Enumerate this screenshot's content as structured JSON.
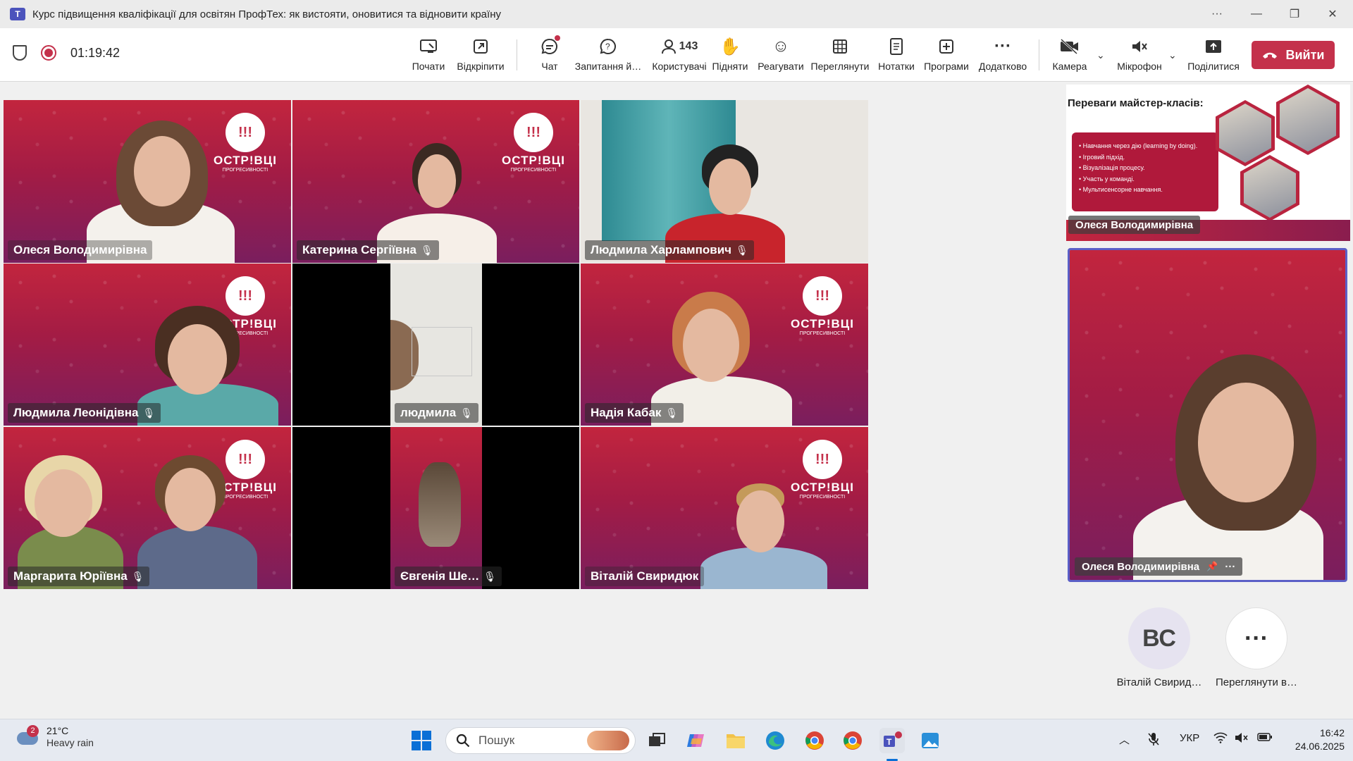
{
  "window": {
    "title": "Курс підвищення кваліфікації для освітян ПрофТех: як вистояти, оновитися та відновити країну",
    "controls": {
      "more": "···",
      "minimize": "—",
      "restore": "❐",
      "close": "✕"
    }
  },
  "toolbar": {
    "timer": "01:19:42",
    "buttons": [
      {
        "label": "Почати",
        "icon": "start-presenting-icon"
      },
      {
        "label": "Відкріпити",
        "icon": "unpin-icon"
      },
      {
        "label": "Чат",
        "icon": "chat-icon"
      },
      {
        "label": "Запитання й…",
        "icon": "questions-icon"
      },
      {
        "label": "Користувачі",
        "icon": "people-icon",
        "count": "143"
      },
      {
        "label": "Підняти",
        "icon": "raise-hand-icon"
      },
      {
        "label": "Реагувати",
        "icon": "react-icon"
      },
      {
        "label": "Переглянути",
        "icon": "view-icon"
      },
      {
        "label": "Нотатки",
        "icon": "notes-icon"
      },
      {
        "label": "Програми",
        "icon": "apps-icon"
      },
      {
        "label": "Додатково",
        "icon": "more-icon"
      },
      {
        "label": "Камера",
        "icon": "camera-off-icon"
      },
      {
        "label": "Мікрофон",
        "icon": "mic-off-icon"
      },
      {
        "label": "Поділитися",
        "icon": "share-icon"
      }
    ],
    "leave_label": "Вийти",
    "accent": "#c4314b"
  },
  "logo": {
    "mark": "!!!",
    "line1": "ОСТР!ВЦІ",
    "line2": "ПРОГРЕСИВНОСТІ"
  },
  "participants": [
    {
      "name": "Олеся Володимирівна",
      "muted": false
    },
    {
      "name": "Катерина Сергіївна",
      "muted": true
    },
    {
      "name": "Людмила Харлампович",
      "muted": true
    },
    {
      "name": "Людмила Леонідівна",
      "muted": true
    },
    {
      "name": "людмила",
      "muted": true
    },
    {
      "name": "Надія Кабак",
      "muted": true
    },
    {
      "name": "Маргарита Юріївна",
      "muted": true
    },
    {
      "name": "Євгенія Ше…",
      "muted": true
    },
    {
      "name": "Віталій Свиридюк",
      "muted": false
    }
  ],
  "mic_glyph": "🎙",
  "slide": {
    "title": "Переваги майстер-класів:",
    "bullets": [
      "Навчання через дію (learning by doing).",
      "Ігровий підхід.",
      "Візуалізація процесу.",
      "Участь у команді.",
      "Мультисенсорне навчання."
    ],
    "presenter": "Олеся Володимирівна"
  },
  "pinned": {
    "name": "Олеся Володимирівна",
    "pin": "📌",
    "more": "···"
  },
  "avatars": [
    {
      "initials": "ВС",
      "label": "Віталій Свирид…"
    },
    {
      "initials": "···",
      "label": "Переглянути в…"
    }
  ],
  "taskbar": {
    "weather": {
      "temp": "21°C",
      "condition": "Heavy rain",
      "badge": "2"
    },
    "search_placeholder": "Пошук",
    "language": "УКР",
    "time": "16:42",
    "date": "24.06.2025"
  }
}
